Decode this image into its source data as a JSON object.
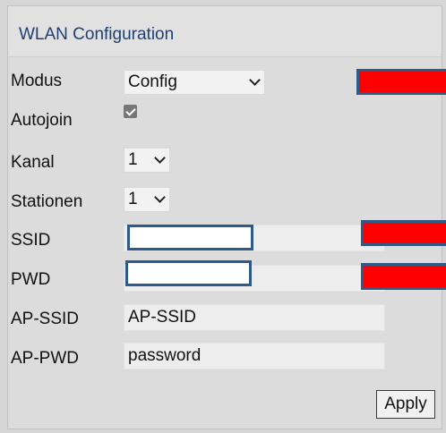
{
  "panel": {
    "title": "WLAN Configuration"
  },
  "fields": {
    "modus": {
      "label": "Modus",
      "value": "Config"
    },
    "autojoin": {
      "label": "Autojoin",
      "checked": true
    },
    "kanal": {
      "label": "Kanal",
      "value": "1"
    },
    "stationen": {
      "label": "Stationen",
      "value": "1"
    },
    "ssid": {
      "label": "SSID",
      "value": ""
    },
    "pwd": {
      "label": "PWD",
      "value": ""
    },
    "ap_ssid": {
      "label": "AP-SSID",
      "value": "AP-SSID"
    },
    "ap_pwd": {
      "label": "AP-PWD",
      "value": "password"
    }
  },
  "apply_button": {
    "label": "Apply"
  },
  "colors": {
    "title": "#1f3f73",
    "redaction_red": "#ff0000",
    "redaction_border": "#2e5a8a"
  },
  "icons": {
    "dropdown": "chevron-down-icon",
    "checkbox": "checkmark-icon"
  }
}
